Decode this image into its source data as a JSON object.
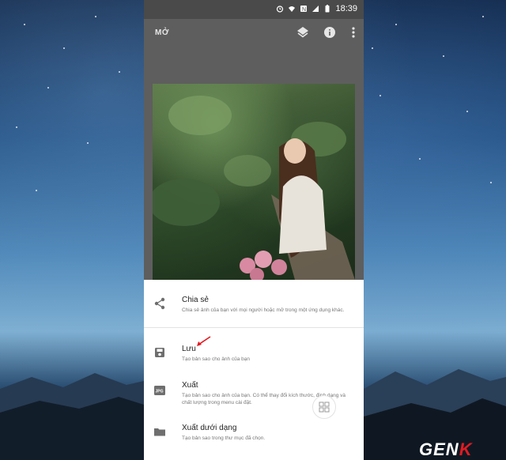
{
  "status_bar": {
    "time": "18:39"
  },
  "toolbar": {
    "title": "MỞ"
  },
  "share_sheet": {
    "items": [
      {
        "label": "Chia sẻ",
        "desc": "Chia sẻ ảnh của bạn với mọi người hoặc mở trong một ứng dụng khác.",
        "icon": "share-icon"
      },
      {
        "label": "Lưu",
        "desc": "Tạo bản sao cho ảnh của bạn",
        "icon": "save-icon"
      },
      {
        "label": "Xuất",
        "desc": "Tạo bản sao cho ảnh của bạn. Có thể thay đổi kích thước, định dạng và chất lượng trong menu cài đặt.",
        "icon": "jpg-icon"
      },
      {
        "label": "Xuất dưới dạng",
        "desc": "Tạo bản sao trong thư mục đã chọn.",
        "icon": "folder-icon"
      }
    ]
  },
  "watermark": {
    "text_main": "GEN",
    "text_accent": "K"
  },
  "colors": {
    "accent_red": "#e11b22",
    "sheet_bg": "#ffffff",
    "app_bg": "#5e5e5e"
  }
}
